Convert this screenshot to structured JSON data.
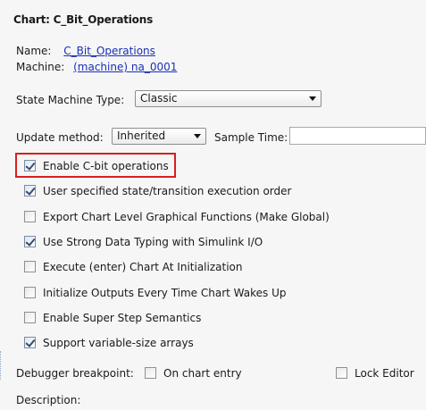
{
  "chart": {
    "title": "Chart: C_Bit_Operations",
    "name_label": "Name:",
    "name_value": "C_Bit_Operations",
    "machine_label": "Machine:",
    "machine_value": "(machine) na_0001"
  },
  "state_machine": {
    "label": "State Machine Type:",
    "value": "Classic",
    "arrow_icon": "chevron-down-icon"
  },
  "update": {
    "method_label": "Update method:",
    "method_value": "Inherited",
    "sample_time_label": "Sample Time:",
    "sample_time_value": ""
  },
  "options": [
    {
      "label": "Enable C-bit operations",
      "checked": true
    },
    {
      "label": "User specified state/transition execution order",
      "checked": true
    },
    {
      "label": "Export Chart Level Graphical Functions (Make Global)",
      "checked": false
    },
    {
      "label": "Use Strong Data Typing with Simulink I/O",
      "checked": true
    },
    {
      "label": "Execute (enter) Chart At Initialization",
      "checked": false
    },
    {
      "label": "Initialize Outputs Every Time Chart Wakes Up",
      "checked": false
    },
    {
      "label": "Enable Super Step Semantics",
      "checked": false
    },
    {
      "label": "Support variable-size arrays",
      "checked": true
    }
  ],
  "debugger": {
    "label": "Debugger breakpoint:",
    "on_chart_entry_label": "On chart entry",
    "on_chart_entry_checked": false,
    "lock_editor_label": "Lock Editor",
    "lock_editor_checked": false
  },
  "description": {
    "label": "Description:"
  },
  "colors": {
    "highlight": "#d62020",
    "link": "#1a2fb8"
  }
}
